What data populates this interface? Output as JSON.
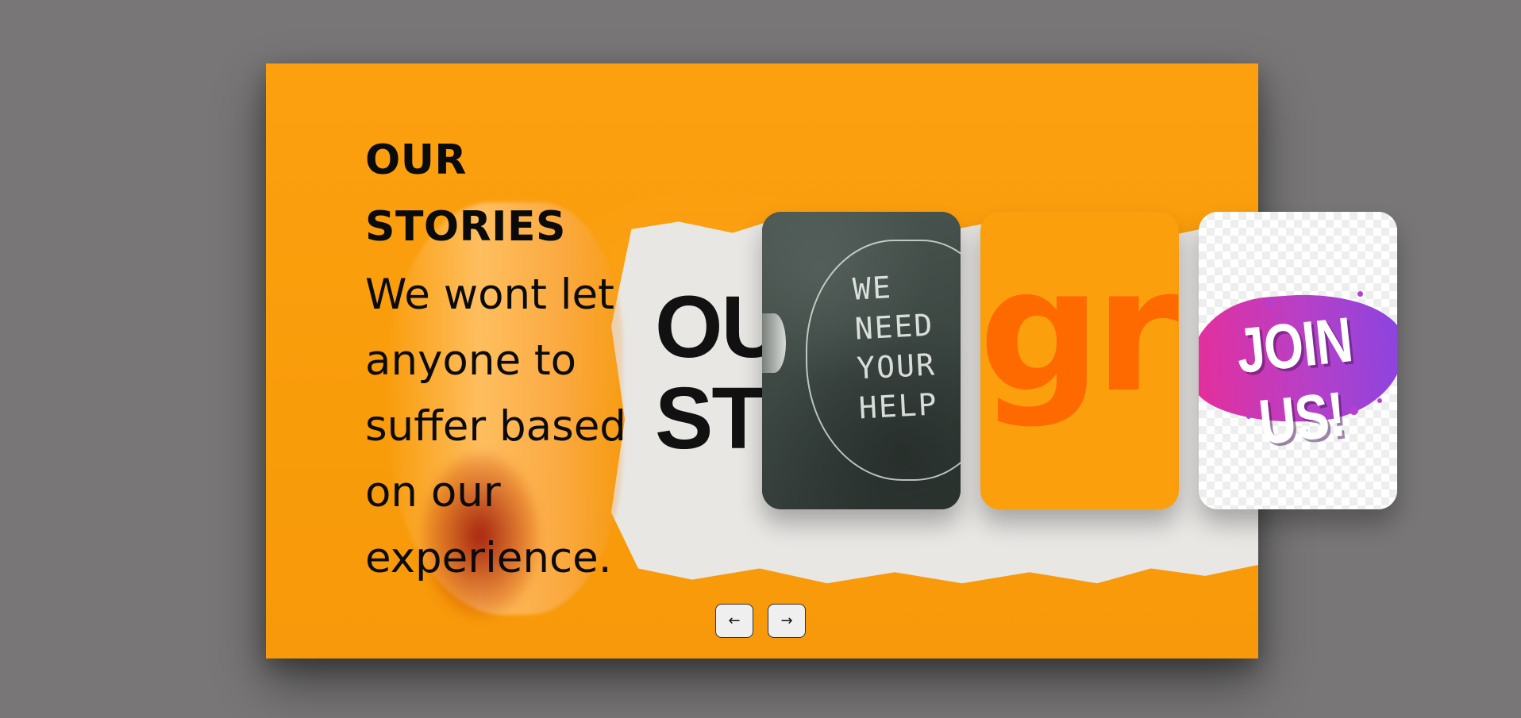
{
  "hero": {
    "title": "OUR STORIES",
    "subtitle": "We wont let anyone to suffer based on our experience.",
    "background_image": "torn-paper-our-stories",
    "background_text": "OU\nST",
    "background_color": "#fb9f0c"
  },
  "cards": [
    {
      "name": "chalkboard-we-need-your-help",
      "text": "WE\nNEED\nYOUR\nHELP"
    },
    {
      "name": "orange-typography-card",
      "text": "gr"
    },
    {
      "name": "join-us-banner",
      "text": "JOIN US!"
    }
  ],
  "controls": {
    "prev_icon": "arrow-left-icon",
    "prev_label": "←",
    "next_icon": "arrow-right-icon",
    "next_label": "→"
  },
  "colors": {
    "page_background": "#787676",
    "accent_orange": "#ff6a00",
    "join_purple": "#b640c8",
    "join_pink": "#e62e9a"
  }
}
